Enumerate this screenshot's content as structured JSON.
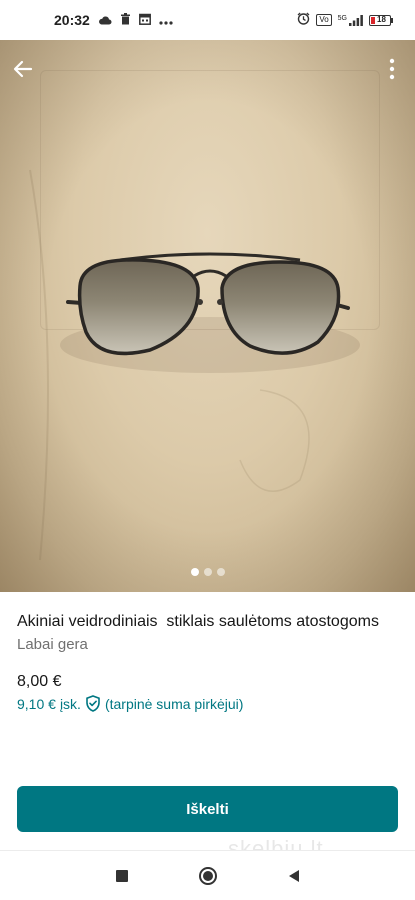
{
  "status_bar": {
    "time": "20:32",
    "battery": "18",
    "network": "5G",
    "icons": [
      "cloud-icon",
      "trash-icon",
      "calendar-icon",
      "more-dots-icon",
      "alarm-icon",
      "volte-icon",
      "signal-icon",
      "battery-icon"
    ]
  },
  "listing": {
    "title": "Akiniai veidrodiniais  stiklais saulėtoms atostogoms",
    "condition": "Labai gera",
    "price": "8,00 €",
    "buyer_price_amount": "9,10 €",
    "buyer_price_incl": "įsk.",
    "buyer_price_note": "(tarpinė suma pirkėjui)"
  },
  "carousel": {
    "total": 3,
    "active_index": 0
  },
  "cta": {
    "label": "Iškelti"
  },
  "watermark": "skelbiu.lt",
  "colors": {
    "accent": "#007782",
    "text": "#171717",
    "muted": "#707070"
  }
}
